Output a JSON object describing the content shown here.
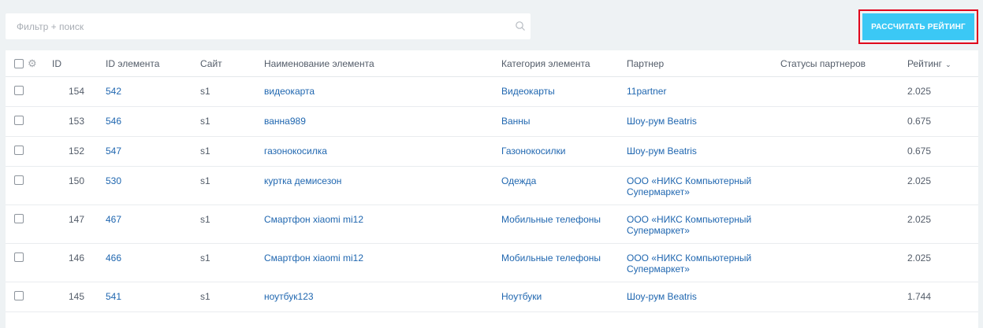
{
  "search": {
    "placeholder": "Фильтр + поиск"
  },
  "toolbar": {
    "calc_label": "РАССЧИТАТЬ РЕЙТИНГ"
  },
  "table": {
    "headers": {
      "id": "ID",
      "element_id": "ID элемента",
      "site": "Сайт",
      "name": "Наименование элемента",
      "category": "Категория элемента",
      "partner": "Партнер",
      "statuses": "Статусы партнеров",
      "rating": "Рейтинг"
    },
    "rows": [
      {
        "id": "154",
        "element_id": "542",
        "site": "s1",
        "name": "видеокарта",
        "category": "Видеокарты",
        "partner": "11partner",
        "status": "",
        "rating": "2.025"
      },
      {
        "id": "153",
        "element_id": "546",
        "site": "s1",
        "name": "ванна989",
        "category": "Ванны",
        "partner": "Шоу-рум Beatris",
        "status": "",
        "rating": "0.675"
      },
      {
        "id": "152",
        "element_id": "547",
        "site": "s1",
        "name": "газонокосилка",
        "category": "Газонокосилки",
        "partner": "Шоу-рум Beatris",
        "status": "",
        "rating": "0.675"
      },
      {
        "id": "150",
        "element_id": "530",
        "site": "s1",
        "name": "куртка демисезон",
        "category": "Одежда",
        "partner": "ООО «НИКС Компьютерный Супермаркет»",
        "status": "",
        "rating": "2.025"
      },
      {
        "id": "147",
        "element_id": "467",
        "site": "s1",
        "name": "Смартфон xiaomi mi12",
        "category": "Мобильные телефоны",
        "partner": "ООО «НИКС Компьютерный Супермаркет»",
        "status": "",
        "rating": "2.025"
      },
      {
        "id": "146",
        "element_id": "466",
        "site": "s1",
        "name": "Смартфон xiaomi mi12",
        "category": "Мобильные телефоны",
        "partner": "ООО «НИКС Компьютерный Супермаркет»",
        "status": "",
        "rating": "2.025"
      },
      {
        "id": "145",
        "element_id": "541",
        "site": "s1",
        "name": "ноутбук123",
        "category": "Ноутбуки",
        "partner": "Шоу-рум Beatris",
        "status": "",
        "rating": "1.744"
      }
    ]
  },
  "icons": {
    "search": "search-icon",
    "settings": "gear-icon",
    "sort": "chevron-down-icon"
  },
  "colors": {
    "accent": "#3bc8f5",
    "link": "#2067b0",
    "highlight": "#e0001b"
  }
}
